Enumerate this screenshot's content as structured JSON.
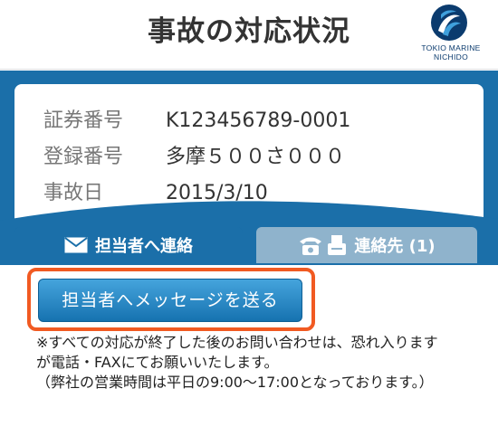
{
  "header": {
    "title": "事故の対応状況",
    "logo_icon": "tokio-marine-nichido-logo",
    "logo_line1": "TOKIO MARINE",
    "logo_line2": "NICHIDO"
  },
  "info": {
    "rows": [
      {
        "label": "証券番号",
        "value": "K123456789-0001"
      },
      {
        "label": "登録番号",
        "value": "多摩５００さ０００"
      },
      {
        "label": "事故日",
        "value": "2015/3/10"
      }
    ]
  },
  "tabs": [
    {
      "label": "担当者へ連絡",
      "icons": [
        "mail-icon"
      ],
      "active": true
    },
    {
      "label": "連絡先 (1)",
      "icons": [
        "phone-icon",
        "fax-icon"
      ],
      "active": false
    }
  ],
  "content": {
    "send_button": "担当者へメッセージを送る",
    "notice_lines": [
      "※すべての対応が終了した後のお問い合わせは、恐れ入ります",
      "が電話・FAXにてお願いいたします。",
      "（弊社の営業時間は平日の9:00〜17:00となっております。）"
    ]
  },
  "colors": {
    "brand_blue": "#1b6fa9",
    "inactive_tab": "#8fb3cc",
    "highlight": "#f15a22"
  }
}
